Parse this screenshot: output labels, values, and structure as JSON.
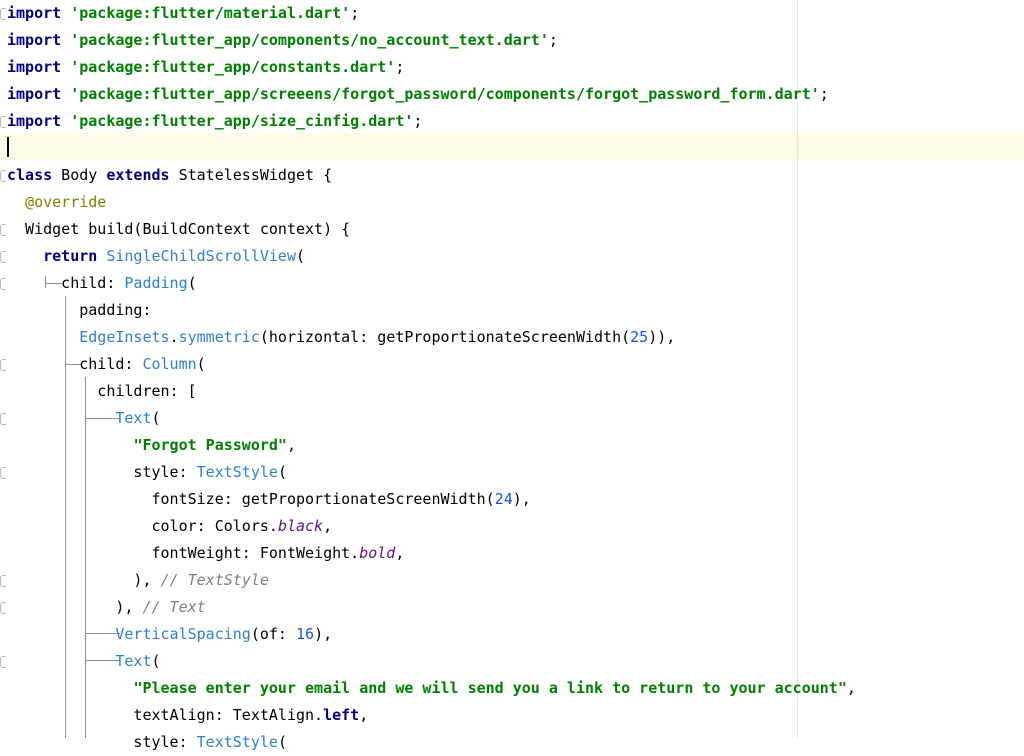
{
  "editor": {
    "language": "dart",
    "line_count": 28,
    "lines": [
      [
        [
          "kw",
          "import"
        ],
        [
          "plain",
          " "
        ],
        [
          "str",
          "'package:flutter/material.dart'"
        ],
        [
          "plain",
          ";"
        ]
      ],
      [
        [
          "kw",
          "import"
        ],
        [
          "plain",
          " "
        ],
        [
          "str",
          "'package:flutter_app/components/no_account_text.dart'"
        ],
        [
          "plain",
          ";"
        ]
      ],
      [
        [
          "kw",
          "import"
        ],
        [
          "plain",
          " "
        ],
        [
          "str",
          "'package:flutter_app/constants.dart'"
        ],
        [
          "plain",
          ";"
        ]
      ],
      [
        [
          "kw",
          "import"
        ],
        [
          "plain",
          " "
        ],
        [
          "str",
          "'package:flutter_app/screeens/forgot_password/components/forgot_password_form.dart'"
        ],
        [
          "plain",
          ";"
        ]
      ],
      [
        [
          "kw",
          "import"
        ],
        [
          "plain",
          " "
        ],
        [
          "str",
          "'package:flutter_app/size_cinfig.dart'"
        ],
        [
          "plain",
          ";"
        ]
      ],
      [],
      [
        [
          "kw",
          "class"
        ],
        [
          "plain",
          " Body "
        ],
        [
          "kw",
          "extends"
        ],
        [
          "plain",
          " StatelessWidget {"
        ]
      ],
      [
        [
          "plain",
          "  "
        ],
        [
          "ann",
          "@override"
        ]
      ],
      [
        [
          "plain",
          "  Widget build(BuildContext context) {"
        ]
      ],
      [
        [
          "plain",
          "    "
        ],
        [
          "kw",
          "return"
        ],
        [
          "plain",
          " "
        ],
        [
          "cls",
          "SingleChildScrollView"
        ],
        [
          "plain",
          "("
        ]
      ],
      [
        [
          "plain",
          "      child: "
        ],
        [
          "cls",
          "Padding"
        ],
        [
          "plain",
          "("
        ]
      ],
      [
        [
          "plain",
          "        padding:"
        ]
      ],
      [
        [
          "plain",
          "        "
        ],
        [
          "cls",
          "EdgeInsets"
        ],
        [
          "plain",
          "."
        ],
        [
          "cls",
          "symmetric"
        ],
        [
          "plain",
          "(horizontal: getProportionateScreenWidth("
        ],
        [
          "num",
          "25"
        ],
        [
          "plain",
          ")),"
        ]
      ],
      [
        [
          "plain",
          "        child: "
        ],
        [
          "cls",
          "Column"
        ],
        [
          "plain",
          "("
        ]
      ],
      [
        [
          "plain",
          "          children: ["
        ]
      ],
      [
        [
          "plain",
          "            "
        ],
        [
          "cls",
          "Text"
        ],
        [
          "plain",
          "("
        ]
      ],
      [
        [
          "plain",
          "              "
        ],
        [
          "str",
          "\"Forgot Password\""
        ],
        [
          "plain",
          ","
        ]
      ],
      [
        [
          "plain",
          "              style: "
        ],
        [
          "cls",
          "TextStyle"
        ],
        [
          "plain",
          "("
        ]
      ],
      [
        [
          "plain",
          "                fontSize: getProportionateScreenWidth("
        ],
        [
          "num",
          "24"
        ],
        [
          "plain",
          "),"
        ]
      ],
      [
        [
          "plain",
          "                color: Colors."
        ],
        [
          "const",
          "black"
        ],
        [
          "plain",
          ","
        ]
      ],
      [
        [
          "plain",
          "                fontWeight: FontWeight."
        ],
        [
          "const",
          "bold"
        ],
        [
          "plain",
          ","
        ]
      ],
      [
        [
          "plain",
          "              ), "
        ],
        [
          "cmt",
          "// TextStyle"
        ]
      ],
      [
        [
          "plain",
          "            ), "
        ],
        [
          "cmt",
          "// Text"
        ]
      ],
      [
        [
          "plain",
          "            "
        ],
        [
          "cls",
          "VerticalSpacing"
        ],
        [
          "plain",
          "(of: "
        ],
        [
          "num",
          "16"
        ],
        [
          "plain",
          "),"
        ]
      ],
      [
        [
          "plain",
          "            "
        ],
        [
          "cls",
          "Text"
        ],
        [
          "plain",
          "("
        ]
      ],
      [
        [
          "plain",
          "              "
        ],
        [
          "str",
          "\"Please enter your email and we will send you a link to return to your account\""
        ],
        [
          "plain",
          ","
        ]
      ],
      [
        [
          "plain",
          "              textAlign: TextAlign."
        ],
        [
          "kw",
          "left"
        ],
        [
          "plain",
          ","
        ]
      ],
      [
        [
          "plain",
          "              style: "
        ],
        [
          "cls",
          "TextStyle"
        ],
        [
          "plain",
          "("
        ]
      ]
    ]
  }
}
